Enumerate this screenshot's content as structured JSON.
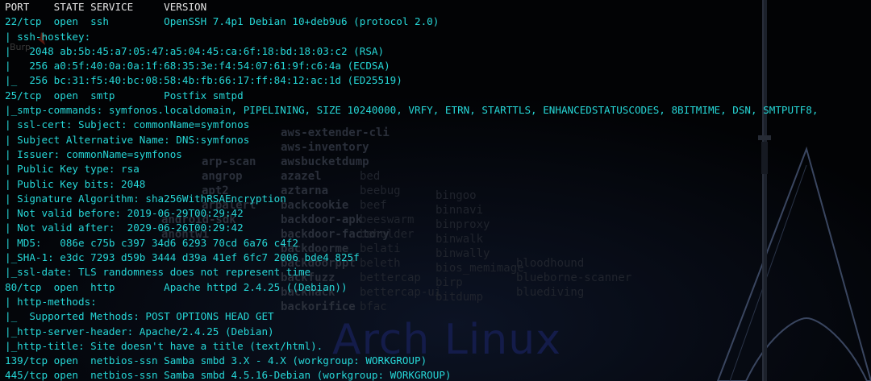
{
  "terminal": {
    "lines": [
      "PORT    STATE SERVICE     VERSION",
      "22/tcp  open  ssh         OpenSSH 7.4p1 Debian 10+deb9u6 (protocol 2.0)",
      "| ssh-hostkey: ",
      "|   2048 ab:5b:45:a7:05:47:a5:04:45:ca:6f:18:bd:18:03:c2 (RSA)",
      "|   256 a0:5f:40:0a:0a:1f:68:35:3e:f4:54:07:61:9f:c6:4a (ECDSA)",
      "|_  256 bc:31:f5:40:bc:08:58:4b:fb:66:17:ff:84:12:ac:1d (ED25519)",
      "25/tcp  open  smtp        Postfix smtpd",
      "|_smtp-commands: symfonos.localdomain, PIPELINING, SIZE 10240000, VRFY, ETRN, STARTTLS, ENHANCEDSTATUSCODES, 8BITMIME, DSN, SMTPUTF8, ",
      "| ssl-cert: Subject: commonName=symfonos",
      "| Subject Alternative Name: DNS:symfonos",
      "| Issuer: commonName=symfonos",
      "| Public Key type: rsa",
      "| Public Key bits: 2048",
      "| Signature Algorithm: sha256WithRSAEncryption",
      "| Not valid before: 2019-06-29T00:29:42",
      "| Not valid after:  2029-06-26T00:29:42",
      "| MD5:   086e c75b c397 34d6 6293 70cd 6a76 c4f2",
      "|_SHA-1: e3dc 7293 d59b 3444 d39a 41ef 6fc7 2006 bde4 825f",
      "|_ssl-date: TLS randomness does not represent time",
      "80/tcp  open  http        Apache httpd 2.4.25 ((Debian))",
      "| http-methods: ",
      "|_  Supported Methods: POST OPTIONS HEAD GET",
      "|_http-server-header: Apache/2.4.25 (Debian)",
      "|_http-title: Site doesn't have a title (text/html).",
      "139/tcp open  netbios-ssn Samba smbd 3.X - 4.X (workgroup: WORKGROUP)",
      "445/tcp open  netbios-ssn Samba smbd 4.5.16-Debian (workgroup: WORKGROUP)"
    ]
  },
  "wallpaper": {
    "watermark": "Arch Linux",
    "burp_text": "Burp",
    "tool_list_col1": [
      "aws-extender-cli",
      "aws-inventory",
      "awsbucketdump",
      "azazel",
      "aztarna",
      "backcookie",
      "backdoor-apk",
      "backdoor-factory",
      "backdoorme",
      "backdoorppt",
      "backfuzz",
      "backhack",
      "backorifice"
    ],
    "tool_list_col2": [
      "bed",
      "beebug",
      "beef",
      "beeswarm",
      "beholder",
      "belati",
      "beleth",
      "bettercap",
      "bettercap-ui",
      "bfac"
    ],
    "tool_list_col3": [
      "bingoo",
      "binnavi",
      "binproxy",
      "binwalk",
      "binwally",
      "bios_memimage",
      "birp",
      "bitdump"
    ],
    "tool_list_col4": [
      "bloodhound",
      "blueborne-scanner",
      "bluediving"
    ],
    "tool_list_left": [
      "angrop",
      "apt2",
      "arp-scan",
      "arpalert",
      "android-sdk",
      "anontwi"
    ]
  },
  "colors": {
    "text": "#26d7d7",
    "header_text": "#e6e6e6",
    "background": "#020305",
    "watermark": "#141c4a"
  }
}
